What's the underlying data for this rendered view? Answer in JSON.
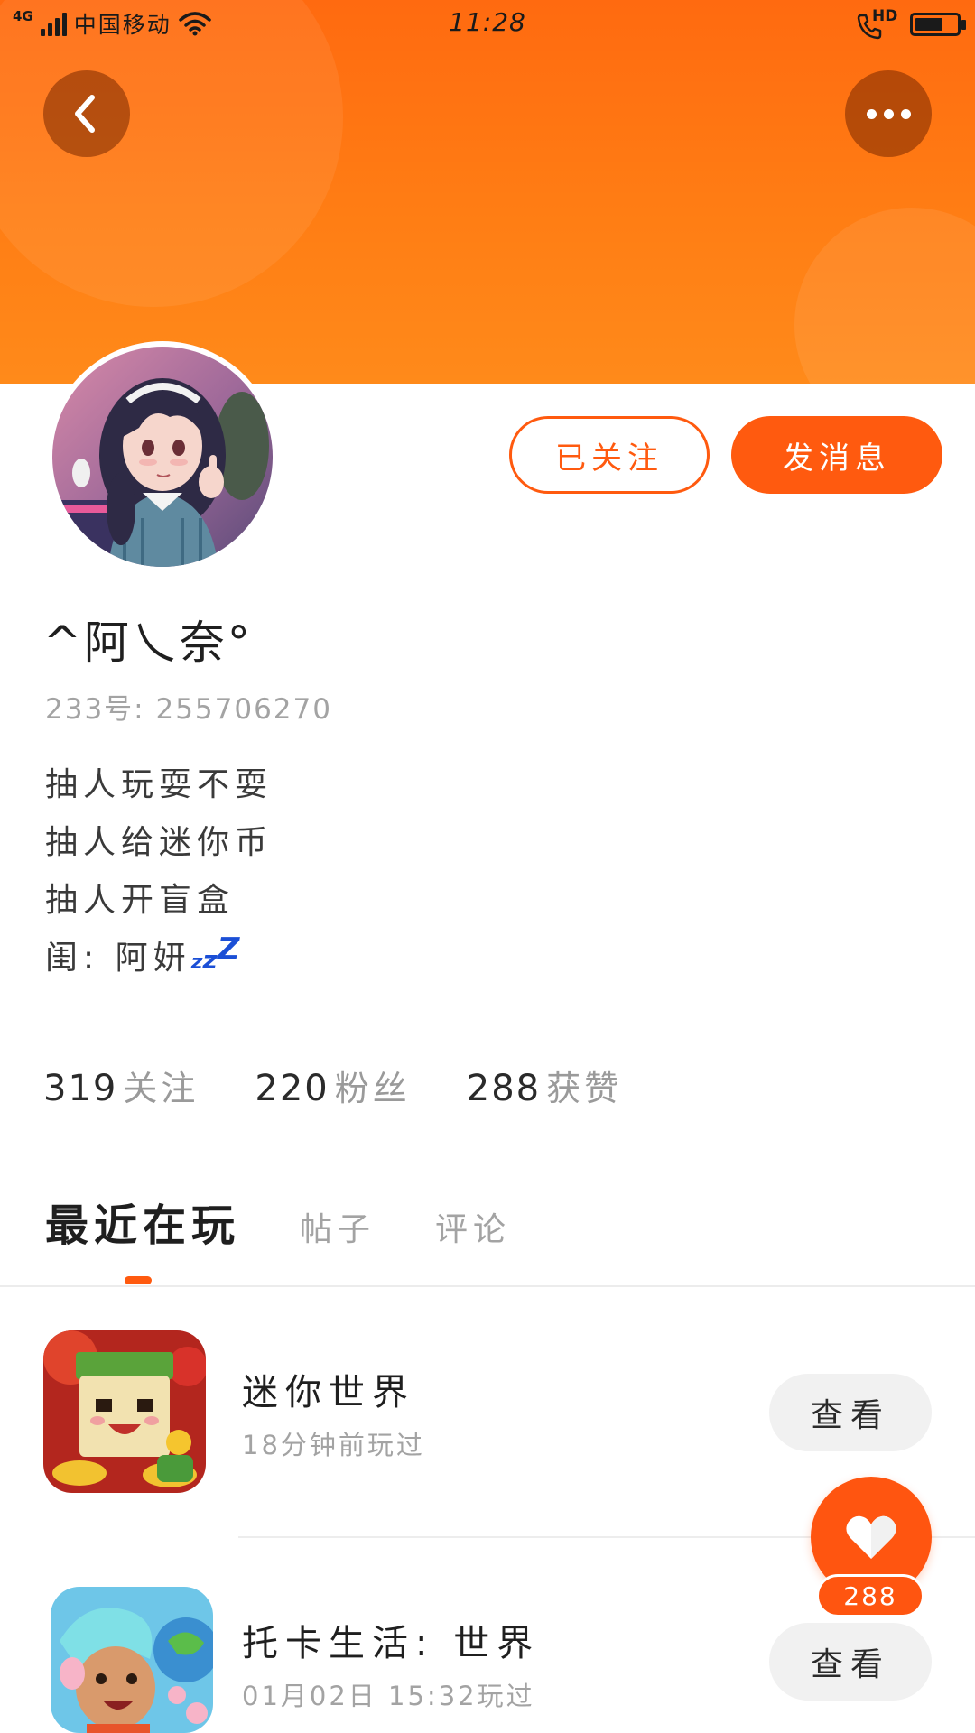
{
  "status_bar": {
    "network_type": "4G",
    "carrier": "中国移动",
    "time": "11:28",
    "hd_label": "HD",
    "icons": [
      "signal-icon",
      "wifi-icon",
      "hd-call-icon",
      "battery-icon"
    ]
  },
  "header": {
    "back_icon": "chevron-left-icon",
    "more_icon": "more-dots-icon",
    "gradient_colors": [
      "#ff6a10",
      "#ff8a1a"
    ]
  },
  "profile": {
    "nickname": "^阿乀奈°",
    "user_id": "233号: 255706270",
    "bio": [
      "抽人玩耍不耍",
      "抽人给迷你币",
      "抽人开盲盒"
    ],
    "bio_last_prefix": "闺: 阿妍",
    "bio_last_emoji": {
      "z1": "z",
      "z2": "z",
      "z3": "Z"
    }
  },
  "actions": {
    "follow_label": "已关注",
    "message_label": "发消息"
  },
  "stats": [
    {
      "value": "319",
      "label": "关注"
    },
    {
      "value": "220",
      "label": "粉丝"
    },
    {
      "value": "288",
      "label": "获赞"
    }
  ],
  "tabs": [
    {
      "label": "最近在玩",
      "active": true
    },
    {
      "label": "帖子",
      "active": false
    },
    {
      "label": "评论",
      "active": false
    }
  ],
  "games": [
    {
      "title": "迷你世界",
      "time": "18分钟前玩过",
      "button": "查看"
    },
    {
      "title": "托卡生活: 世界",
      "time": "01月02日 15:32玩过",
      "button": "查看"
    }
  ],
  "like_fab": {
    "count": "288",
    "icon": "heart-icon"
  },
  "colors": {
    "accent": "#ff5a0f",
    "zzz_blue": "#1b4fd6"
  }
}
